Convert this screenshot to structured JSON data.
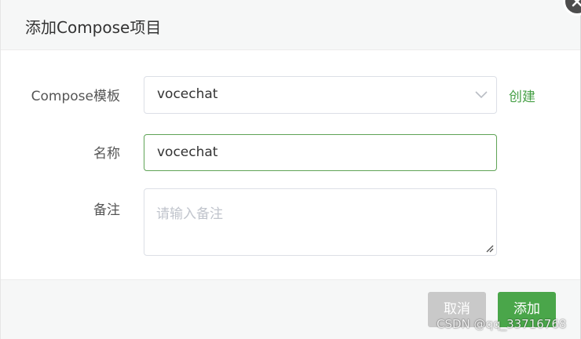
{
  "dialog": {
    "title": "添加Compose项目"
  },
  "form": {
    "template": {
      "label": "Compose模板",
      "value": "vocechat",
      "create_link": "创建"
    },
    "name": {
      "label": "名称",
      "value": "vocechat"
    },
    "remark": {
      "label": "备注",
      "placeholder": "请输入备注"
    }
  },
  "footer": {
    "cancel_label": "取消",
    "add_label": "添加"
  },
  "watermark": "CSDN @qq_33716768",
  "colors": {
    "accent": "#4aa64a",
    "link": "#47a046",
    "cancel_bg": "#c9c9c9",
    "header_bg": "#f6f7f7"
  },
  "icons": {
    "close": "close-icon",
    "select_arrow": "chevron-down-icon",
    "resize": "resize-grip-icon"
  }
}
